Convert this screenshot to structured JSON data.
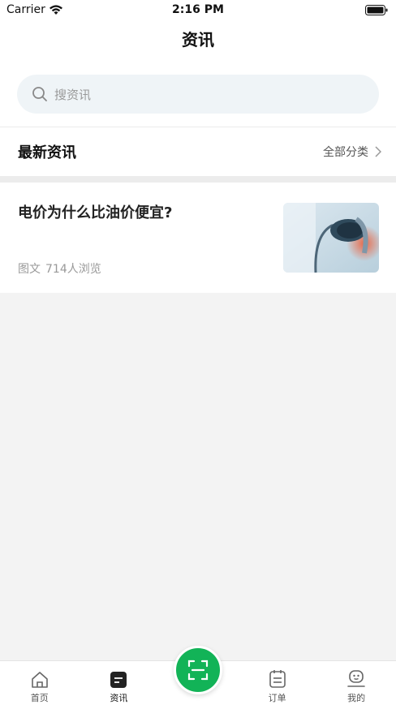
{
  "status": {
    "carrier": "Carrier",
    "time": "2:16 PM"
  },
  "header": {
    "title": "资讯"
  },
  "search": {
    "placeholder": "搜资讯"
  },
  "section": {
    "title": "最新资讯",
    "link_label": "全部分类"
  },
  "news": [
    {
      "title": "电价为什么比油价便宜?",
      "type": "图文",
      "views": "714人浏览"
    }
  ],
  "tabs": [
    {
      "label": "首页",
      "icon": "home-icon"
    },
    {
      "label": "资讯",
      "icon": "news-icon"
    },
    {
      "label": "",
      "icon": "scan-icon"
    },
    {
      "label": "订单",
      "icon": "order-icon"
    },
    {
      "label": "我的",
      "icon": "profile-icon"
    }
  ],
  "colors": {
    "accent": "#12b357",
    "background": "#f3f3f3"
  }
}
